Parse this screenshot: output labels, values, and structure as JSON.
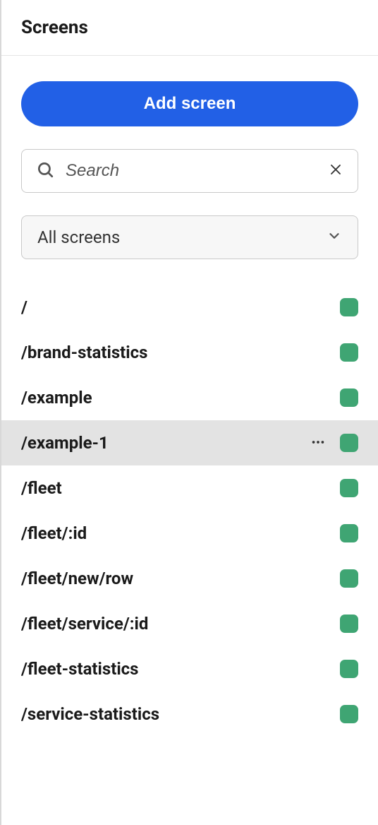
{
  "header": {
    "title": "Screens"
  },
  "controls": {
    "add_button_label": "Add screen",
    "search_placeholder": "Search",
    "filter_selected": "All screens"
  },
  "status_color": "#3FA573",
  "screens": [
    {
      "path": "/",
      "selected": false,
      "show_more": false,
      "status": "green"
    },
    {
      "path": "/brand-statistics",
      "selected": false,
      "show_more": false,
      "status": "green"
    },
    {
      "path": "/example",
      "selected": false,
      "show_more": false,
      "status": "green"
    },
    {
      "path": "/example-1",
      "selected": true,
      "show_more": true,
      "status": "green"
    },
    {
      "path": "/fleet",
      "selected": false,
      "show_more": false,
      "status": "green"
    },
    {
      "path": "/fleet/:id",
      "selected": false,
      "show_more": false,
      "status": "green"
    },
    {
      "path": "/fleet/new/row",
      "selected": false,
      "show_more": false,
      "status": "green"
    },
    {
      "path": "/fleet/service/:id",
      "selected": false,
      "show_more": false,
      "status": "green"
    },
    {
      "path": "/fleet-statistics",
      "selected": false,
      "show_more": false,
      "status": "green"
    },
    {
      "path": "/service-statistics",
      "selected": false,
      "show_more": false,
      "status": "green"
    }
  ]
}
